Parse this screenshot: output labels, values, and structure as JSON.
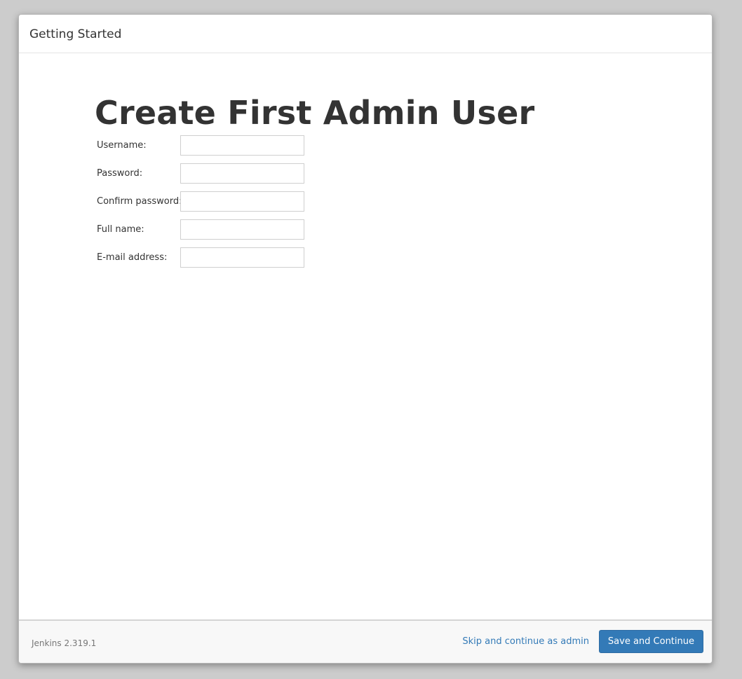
{
  "dialog": {
    "title": "Getting Started"
  },
  "form": {
    "heading": "Create First Admin User",
    "fields": [
      {
        "label": "Username:",
        "value": "",
        "type": "text"
      },
      {
        "label": "Password:",
        "value": "",
        "type": "password"
      },
      {
        "label": "Confirm password:",
        "value": "",
        "type": "password"
      },
      {
        "label": "Full name:",
        "value": "",
        "type": "text"
      },
      {
        "label": "E-mail address:",
        "value": "",
        "type": "text"
      }
    ]
  },
  "footer": {
    "version": "Jenkins 2.319.1",
    "skip_label": "Skip and continue as admin",
    "save_label": "Save and Continue"
  },
  "colors": {
    "primary": "#337ab7",
    "backdrop": "#cccccc",
    "text": "#333333"
  }
}
